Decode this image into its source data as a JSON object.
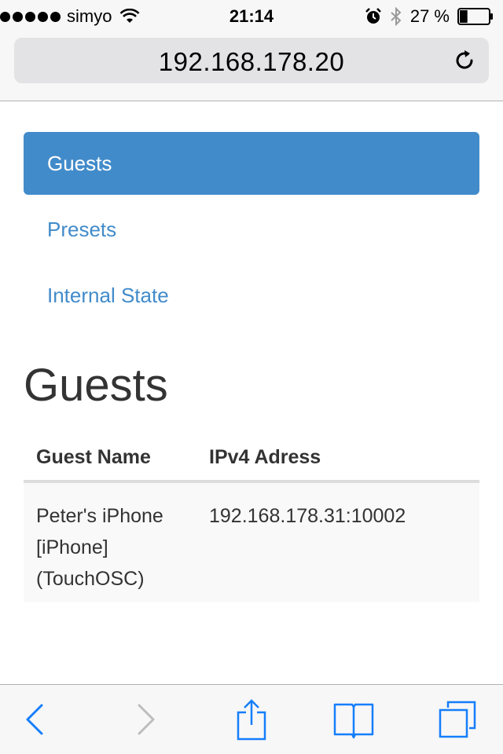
{
  "status_bar": {
    "carrier": "simyo",
    "time": "21:14",
    "battery_percent": "27 %",
    "battery_level": 0.27,
    "signal_dots": 5,
    "icons": [
      "signal-dots-icon",
      "wifi-icon",
      "alarm-icon",
      "bluetooth-icon",
      "battery-icon"
    ]
  },
  "address_bar": {
    "url": "192.168.178.20",
    "reload_icon": "reload-icon"
  },
  "nav": {
    "items": [
      {
        "label": "Guests",
        "active": true
      },
      {
        "label": "Presets",
        "active": false
      },
      {
        "label": "Internal State",
        "active": false
      }
    ]
  },
  "main": {
    "title": "Guests",
    "table": {
      "headers": [
        "Guest Name",
        "IPv4 Adress"
      ],
      "rows": [
        {
          "name_lines": [
            "Peter's iPhone",
            "[iPhone]",
            "(TouchOSC)"
          ],
          "ip": "192.168.178.31:10002"
        }
      ]
    }
  },
  "toolbar": {
    "icons": [
      "back-icon",
      "forward-icon",
      "share-icon",
      "bookmarks-icon",
      "tabs-icon"
    ]
  },
  "colors": {
    "accent": "#428bca",
    "ios_blue": "#157efb",
    "disabled": "#bdbdbd"
  }
}
